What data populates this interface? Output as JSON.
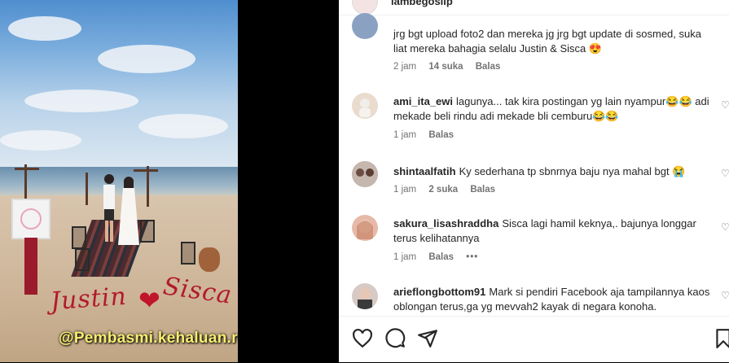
{
  "header": {
    "username": "lambegosiip"
  },
  "media": {
    "watermark": "@Pembasmi.kehaluan.reall",
    "sand_text_left": "Justin",
    "sand_text_right": "Sisca"
  },
  "comments": [
    {
      "user": "",
      "text": "jrg bgt upload foto2 dan mereka jg jrg bgt update di sosmed, suka liat mereka bahagia selalu Justin & Sisca 😍",
      "time": "2 jam",
      "likes": "14 suka",
      "reply": "Balas"
    },
    {
      "user": "ami_ita_ewi",
      "text": "lagunya... tak kira postingan yg lain nyampur😂😂 adi mekade beli rindu adi mekade bli cemburu😂😂",
      "time": "1 jam",
      "likes": "",
      "reply": "Balas"
    },
    {
      "user": "shintaalfatih",
      "text": "Ky sederhana tp sbnrnya baju nya mahal bgt 😭",
      "time": "1 jam",
      "likes": "2 suka",
      "reply": "Balas"
    },
    {
      "user": "sakura_lisashraddha",
      "text": "Sisca lagi hamil keknya,. bajunya longgar terus kelihatannya",
      "time": "1 jam",
      "likes": "",
      "reply": "Balas",
      "more": "•••"
    },
    {
      "user": "arieflongbottom91",
      "text": "Mark si pendiri Facebook aja tampilannya kaos oblongan terus,ga yg mevvah2 kayak di negara konoha.",
      "time": "",
      "likes": "",
      "reply": ""
    }
  ],
  "icons": {
    "like": "heart-icon",
    "comment": "comment-icon",
    "share": "share-icon",
    "save": "bookmark-icon"
  },
  "colors": {
    "text": "#262626",
    "meta": "#737373",
    "watermark": "#f7ee70",
    "petals": "#b21a2b"
  }
}
